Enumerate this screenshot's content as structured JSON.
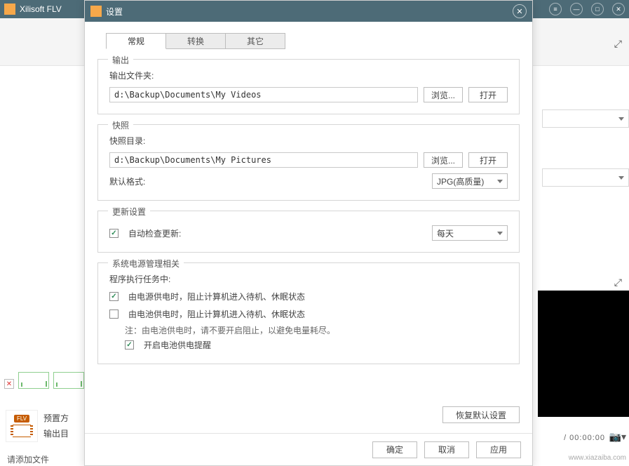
{
  "app": {
    "title": "Xilisoft FLV"
  },
  "dialog": {
    "title": "设置",
    "tabs": {
      "general": "常规",
      "convert": "转换",
      "other": "其它"
    },
    "output": {
      "legend": "输出",
      "folder_label": "输出文件夹:",
      "folder_path": "d:\\Backup\\Documents\\My Videos",
      "browse": "浏览...",
      "open": "打开"
    },
    "snapshot": {
      "legend": "快照",
      "dir_label": "快照目录:",
      "dir_path": "d:\\Backup\\Documents\\My Pictures",
      "browse": "浏览...",
      "open": "打开",
      "format_label": "默认格式:",
      "format_value": "JPG(高质量)"
    },
    "update": {
      "legend": "更新设置",
      "auto_check_label": "自动检查更新:",
      "freq_value": "每天"
    },
    "power": {
      "legend": "系统电源管理相关",
      "tasks_label": "程序执行任务中:",
      "plugged_label": "由电源供电时，阻止计算机进入待机、休眠状态",
      "battery_label": "由电池供电时，阻止计算机进入待机、休眠状态",
      "note_label": "注：由电池供电时，请不要开启阻止，以避免电量耗尽。",
      "reminder_label": "开启电池供电提醒"
    },
    "restore_defaults": "恢复默认设置",
    "footer": {
      "ok": "确定",
      "cancel": "取消",
      "apply": "应用"
    }
  },
  "main": {
    "preset_label": "预置方",
    "output_dir_label": "输出目",
    "add_file_hint": "请添加文件",
    "time_readout": "/ 00:00:00"
  },
  "watermark": "www.xiazaiba.com"
}
